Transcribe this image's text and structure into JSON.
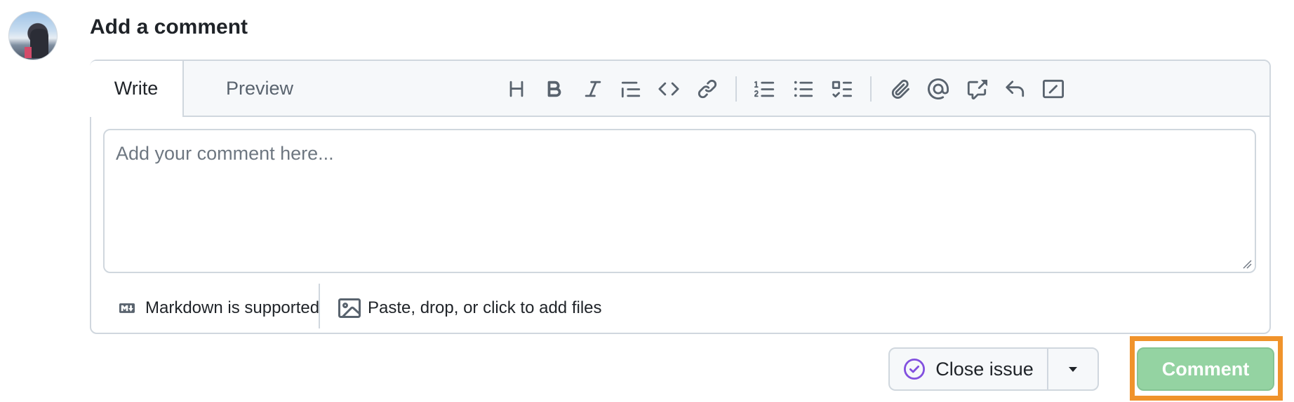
{
  "header": {
    "title": "Add a comment"
  },
  "editor": {
    "tabs": {
      "write": "Write",
      "preview": "Preview"
    },
    "toolbar_icons": [
      "heading-icon",
      "bold-icon",
      "italic-icon",
      "quote-icon",
      "code-icon",
      "link-icon",
      "numbered-list-icon",
      "bulleted-list-icon",
      "task-list-icon",
      "attach-icon",
      "mention-icon",
      "cross-reference-icon",
      "saved-replies-icon",
      "slash-commands-icon"
    ],
    "textarea": {
      "placeholder": "Add your comment here...",
      "value": ""
    },
    "footer": {
      "markdown_label": "Markdown is supported",
      "files_label": "Paste, drop, or click to add files"
    }
  },
  "actions": {
    "close_issue_label": "Close issue",
    "comment_label": "Comment",
    "accent_colors": {
      "close_icon": "#8250df",
      "comment_disabled": "#94d3a2",
      "highlight": "#f0932b"
    }
  }
}
